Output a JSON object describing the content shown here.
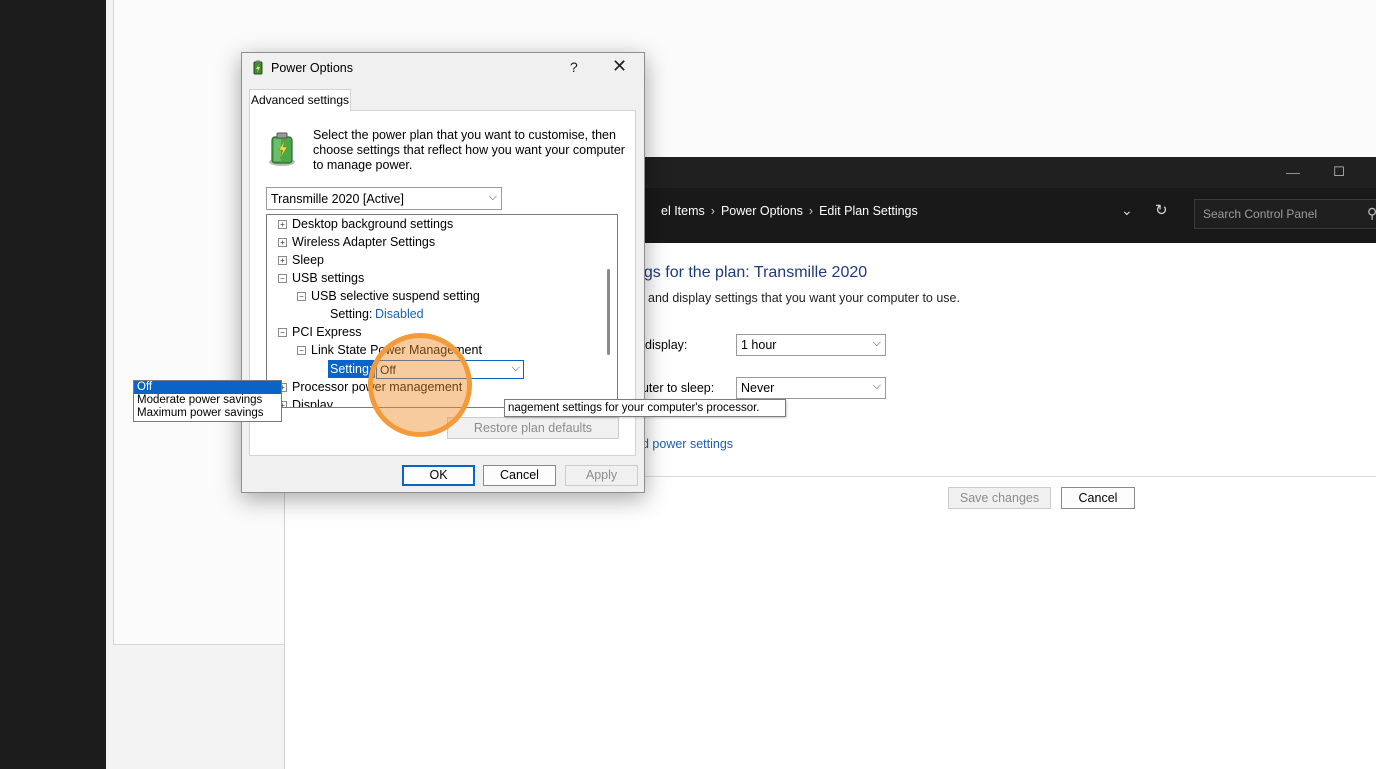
{
  "control_panel": {
    "breadcrumb": [
      "el Items",
      "Power Options",
      "Edit Plan Settings"
    ],
    "breadcrumb_sep": "›",
    "chevron_glyph": "⌄",
    "refresh_glyph": "↻",
    "search_placeholder": "Search Control Panel",
    "search_glyph": "⚲",
    "minimize_glyph": "—",
    "maximize_glyph": "☐",
    "heading": "ngs for the plan: Transmille 2020",
    "subtext": "and display settings that you want your computer to use.",
    "display_label": "display:",
    "display_value": "1 hour",
    "sleep_label": "puter to sleep:",
    "sleep_value": "Never",
    "advanced_link": "d power settings",
    "save_button": "Save changes",
    "cancel_button": "Cancel"
  },
  "dialog": {
    "title": "Power Options",
    "help_glyph": "?",
    "close_glyph": "✕",
    "tab_label": "Advanced settings",
    "intro_text": "Select the power plan that you want to customise, then choose settings that reflect how you want your computer to manage power.",
    "plan_selected": "Transmille 2020 [Active]",
    "dropdown_arrow": "⌵",
    "tree": [
      {
        "label": "Desktop background settings",
        "level": 0,
        "box": "+"
      },
      {
        "label": "Wireless Adapter Settings",
        "level": 0,
        "box": "+"
      },
      {
        "label": "Sleep",
        "level": 0,
        "box": "+"
      },
      {
        "label": "USB settings",
        "level": 0,
        "box": "−"
      },
      {
        "label": "USB selective suspend setting",
        "level": 1,
        "box": "−"
      },
      {
        "label": "Setting:",
        "level": 2,
        "value": "Disabled"
      },
      {
        "label": "PCI Express",
        "level": 0,
        "box": "−"
      },
      {
        "label": "Link State Power Management",
        "level": 1,
        "box": "−"
      },
      {
        "label": "Setting:",
        "level": 2
      },
      {
        "label": "Processor power management",
        "level": 0,
        "box": "+"
      },
      {
        "label": "Display",
        "level": 0,
        "box": "+"
      }
    ],
    "setting_dropdown_value": "Off",
    "setting_options": [
      "Off",
      "Moderate power savings",
      "Maximum power savings"
    ],
    "tooltip": "nagement settings for your computer's processor.",
    "restore_button": "Restore plan defaults",
    "ok_button": "OK",
    "cancel_button": "Cancel",
    "apply_button": "Apply"
  },
  "colors": {
    "accent": "#0a64c8",
    "link": "#1a5fb4",
    "heading": "#1e3c78",
    "highlight": "#f39a3a"
  }
}
